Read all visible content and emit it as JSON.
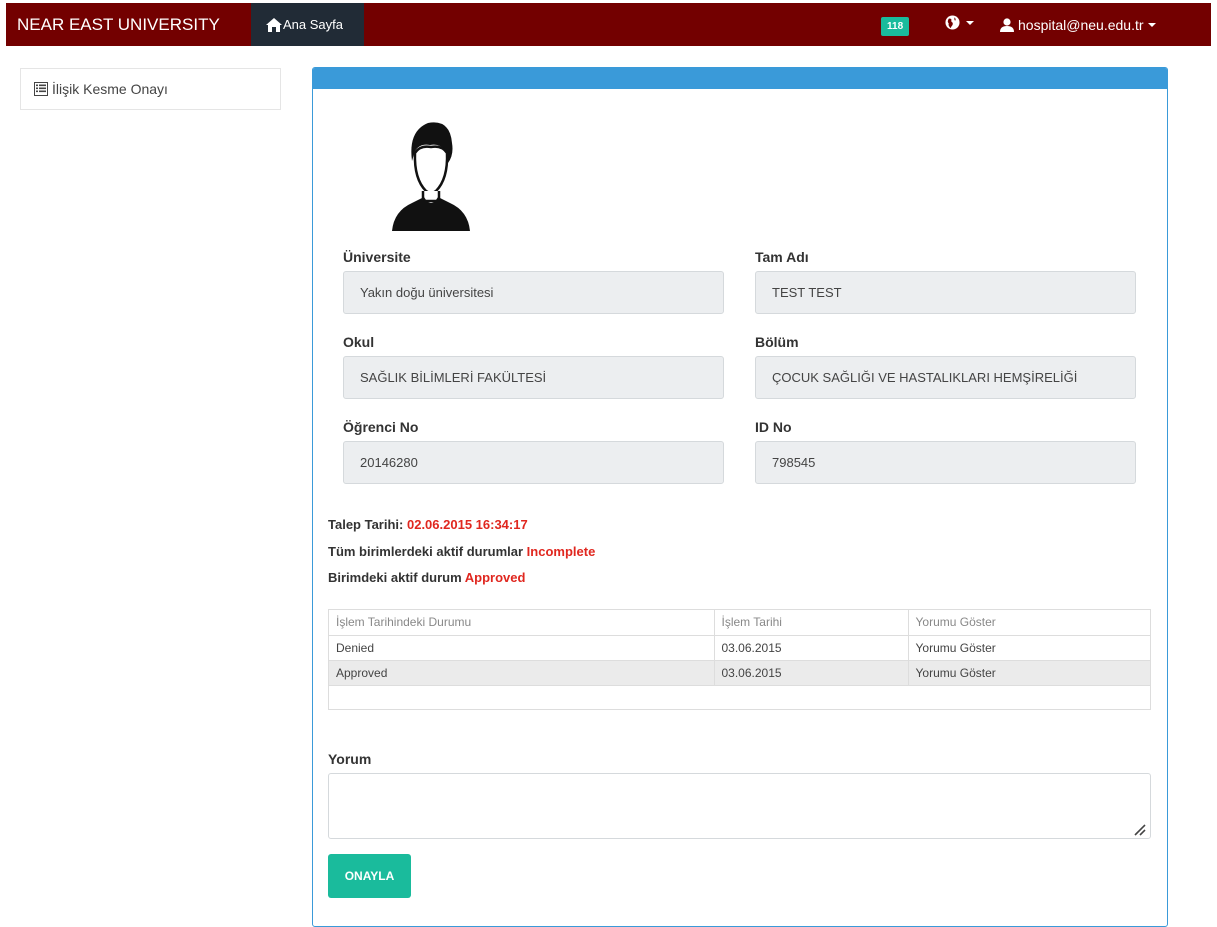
{
  "navbar": {
    "brand": "NEAR EAST UNIVERSITY",
    "home_label": "Ana Sayfa",
    "badge_count": "118",
    "user_email": "hospital@neu.edu.tr",
    "background_color": "#730000",
    "active_tab_color": "#212b36",
    "badge_color": "#1abb9c"
  },
  "sidebar": {
    "items": [
      {
        "label": "İlişik Kesme Onayı",
        "icon": "list-alt-icon"
      }
    ]
  },
  "panel": {
    "header_color": "#3a9ad9",
    "fields": {
      "universite": {
        "label": "Üniversite",
        "value": "Yakın doğu üniversitesi"
      },
      "tam_adi": {
        "label": "Tam Adı",
        "value": "TEST TEST"
      },
      "okul": {
        "label": "Okul",
        "value": "SAĞLIK BİLİMLERİ FAKÜLTESİ"
      },
      "bolum": {
        "label": "Bölüm",
        "value": "ÇOCUK SAĞLIĞI VE HASTALIKLARI HEMŞİRELİĞİ"
      },
      "ogrenci_no": {
        "label": "Öğrenci No",
        "value": "20146280"
      },
      "id_no": {
        "label": "ID No",
        "value": "798545"
      }
    },
    "status": {
      "talep_label": "Talep Tarihi:",
      "talep_value": "02.06.2015 16:34:17",
      "tum_label": "Tüm birimlerdeki aktif durumlar",
      "tum_value": "Incomplete",
      "birim_label": "Birimdeki aktif durum",
      "birim_value": "Approved",
      "highlight_color": "#e0271f"
    },
    "table": {
      "headers": [
        "İşlem Tarihindeki Durumu",
        "İşlem Tarihi",
        "Yorumu Göster"
      ],
      "rows": [
        [
          "Denied",
          "03.06.2015",
          "Yorumu Göster"
        ],
        [
          "Approved",
          "03.06.2015",
          "Yorumu Göster"
        ]
      ]
    },
    "yorum_label": "Yorum",
    "yorum_value": "",
    "submit_label": "ONAYLA",
    "submit_color": "#1abb9c"
  }
}
